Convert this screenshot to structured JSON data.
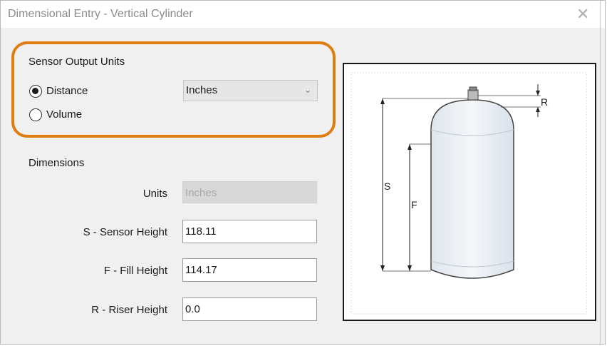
{
  "window": {
    "title": "Dimensional Entry - Vertical Cylinder",
    "close_glyph": "✕"
  },
  "output_units": {
    "heading": "Sensor Output Units",
    "options": [
      {
        "label": "Distance",
        "checked": true
      },
      {
        "label": "Volume",
        "checked": false
      }
    ],
    "unit_select": {
      "value": "Inches"
    },
    "highlight_color": "#e07d10"
  },
  "dimensions": {
    "heading": "Dimensions",
    "units_label": "Units",
    "units_value": "Inches",
    "fields": [
      {
        "label": "S - Sensor Height",
        "value": "118.11"
      },
      {
        "label": "F - Fill Height",
        "value": "114.17"
      },
      {
        "label": "R - Riser Height",
        "value": "0.0"
      }
    ]
  },
  "diagram": {
    "labels": {
      "s": "S",
      "f": "F",
      "r": "R"
    }
  }
}
